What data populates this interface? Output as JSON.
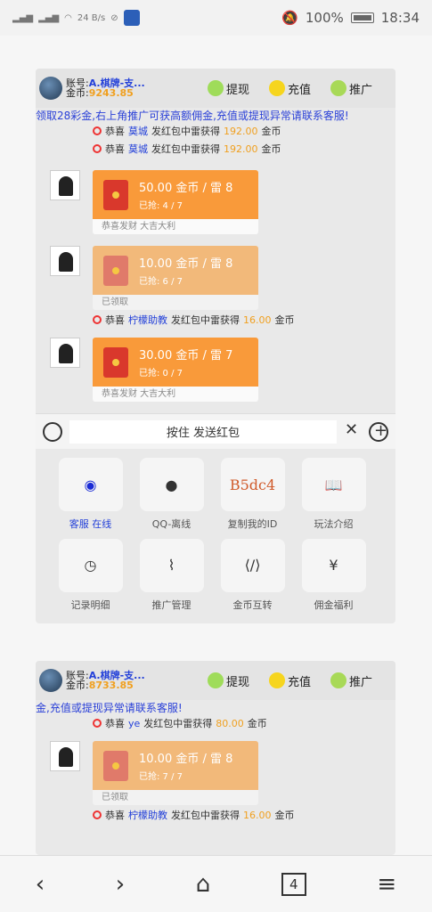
{
  "status_bar": {
    "network_speed": "24\nB/s",
    "battery": "100%",
    "time": "18:34"
  },
  "panel1": {
    "account_label": "账号:",
    "coins_label": "金币:",
    "account_name": "A.棋牌-支...",
    "coins": "9243.85",
    "withdraw": "提现",
    "recharge": "充值",
    "promote": "推广",
    "marquee": "领取28彩金,右上角推广可获高额佣金,充值或提现异常请联系客服!",
    "notices_top": [
      {
        "prefix": "恭喜",
        "who": "莫城",
        "mid": "发红包中雷获得",
        "amount": "192.00",
        "suffix": "金币"
      },
      {
        "prefix": "恭喜",
        "who": "莫城",
        "mid": "发红包中雷获得",
        "amount": "192.00",
        "suffix": "金币"
      }
    ],
    "messages": [
      {
        "amount_text": "50.00 金币 / 雷 8",
        "grabbed": "已抢: 4 / 7",
        "footer": "恭喜发财 大吉大利"
      },
      {
        "amount_text": "10.00 金币 / 雷 8",
        "grabbed": "已抢: 6 / 7",
        "footer": "已领取"
      },
      {
        "amount_text": "30.00 金币 / 雷 7",
        "grabbed": "已抢: 0 / 7",
        "footer": "恭喜发财 大吉大利"
      }
    ],
    "notice_mid": {
      "prefix": "恭喜",
      "who": "柠檬助教",
      "mid": "发红包中雷获得",
      "amount": "16.00",
      "suffix": "金币"
    },
    "send_button": "按住 发送红包",
    "tools": [
      {
        "label": "客服 在线",
        "icon": "compass"
      },
      {
        "label": "QQ-离线",
        "icon": "qq"
      },
      {
        "label": "复制我的ID",
        "icon": "B5dc4"
      },
      {
        "label": "玩法介绍",
        "icon": "book"
      },
      {
        "label": "记录明细",
        "icon": "clock"
      },
      {
        "label": "推广管理",
        "icon": "pulse"
      },
      {
        "label": "金币互转",
        "icon": "code"
      },
      {
        "label": "佣金福利",
        "icon": "yen"
      }
    ]
  },
  "panel2": {
    "account_label": "账号:",
    "coins_label": "金币:",
    "account_name": "A.棋牌-支...",
    "coins": "8733.85",
    "withdraw": "提现",
    "recharge": "充值",
    "promote": "推广",
    "marquee": "金,充值或提现异常请联系客服!",
    "notice_top": {
      "prefix": "恭喜",
      "who": "ye",
      "mid": "发红包中雷获得",
      "amount": "80.00",
      "suffix": "金币"
    },
    "message": {
      "amount_text": "10.00 金币 / 雷 8",
      "grabbed": "已抢: 7 / 7",
      "footer": "已领取"
    },
    "notice_mid": {
      "prefix": "恭喜",
      "who": "柠檬助教",
      "mid": "发红包中雷获得",
      "amount": "16.00",
      "suffix": "金币"
    }
  },
  "bottom_nav": {
    "tab_count": "4"
  },
  "colors": {
    "accent_orange": "#f99a3a",
    "pale_orange": "#f2b97a",
    "link_blue": "#2340d9",
    "gold": "#f0a020"
  }
}
